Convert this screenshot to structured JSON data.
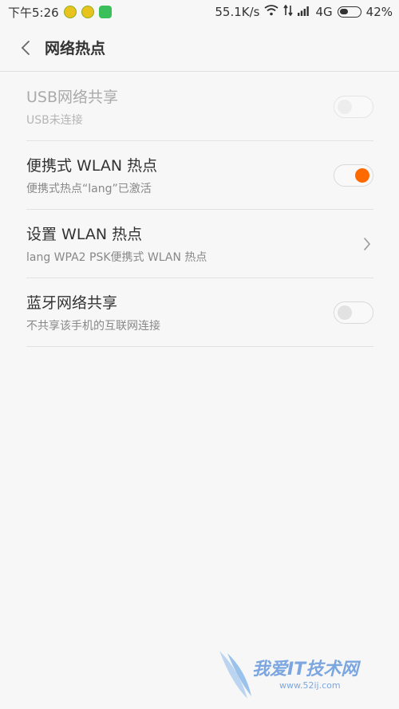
{
  "status_bar": {
    "time": "下午5:26",
    "speed": "55.1K/s",
    "network": "4G",
    "battery": "42%"
  },
  "header": {
    "title": "网络热点"
  },
  "rows": [
    {
      "title": "USB网络共享",
      "subtitle": "USB未连接",
      "control": "toggle",
      "state": "off",
      "enabled": false
    },
    {
      "title": "便携式 WLAN 热点",
      "subtitle": "便携式热点“lang”已激活",
      "control": "toggle",
      "state": "on",
      "enabled": true
    },
    {
      "title": "设置 WLAN 热点",
      "subtitle": "lang WPA2 PSK便携式 WLAN 热点",
      "control": "chevron",
      "enabled": true
    },
    {
      "title": "蓝牙网络共享",
      "subtitle": "不共享该手机的互联网连接",
      "control": "toggle",
      "state": "off",
      "enabled": true
    }
  ],
  "colors": {
    "accent": "#ff6a00",
    "background": "#f7f7f7"
  },
  "watermark": {
    "text": "我爱IT技术网",
    "url": "www.52ij.com"
  }
}
